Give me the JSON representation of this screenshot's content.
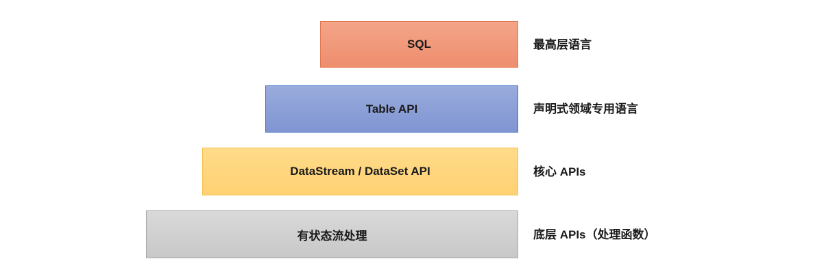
{
  "layers": [
    {
      "label": "SQL",
      "description": "最高层语言",
      "color": "#f19c7c"
    },
    {
      "label": "Table API",
      "description": "声明式领域专用语言",
      "color": "#8ea0d6"
    },
    {
      "label": "DataStream / DataSet API",
      "description": "核心 APIs",
      "color": "#ffd57f"
    },
    {
      "label": "有状态流处理",
      "description": "底层 APIs（处理函数）",
      "color": "#d0d0d0"
    }
  ]
}
